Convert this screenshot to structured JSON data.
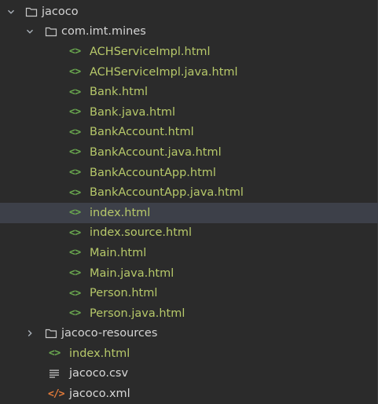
{
  "colors": {
    "background": "#2b2b2b",
    "selected_row": "#3d4049",
    "html_file_text": "#b7c96a",
    "html_icon": "#6aa84f",
    "xml_icon": "#e07a3a"
  },
  "tree": {
    "root": {
      "label": "jacoco",
      "icon": "folder-icon",
      "expanded": true
    },
    "package": {
      "label": "com.imt.mines",
      "icon": "folder-icon",
      "expanded": true
    },
    "package_files": [
      {
        "label": "ACHServiceImpl.html",
        "icon": "html-icon"
      },
      {
        "label": "ACHServiceImpl.java.html",
        "icon": "html-icon"
      },
      {
        "label": "Bank.html",
        "icon": "html-icon"
      },
      {
        "label": "Bank.java.html",
        "icon": "html-icon"
      },
      {
        "label": "BankAccount.html",
        "icon": "html-icon"
      },
      {
        "label": "BankAccount.java.html",
        "icon": "html-icon"
      },
      {
        "label": "BankAccountApp.html",
        "icon": "html-icon"
      },
      {
        "label": "BankAccountApp.java.html",
        "icon": "html-icon"
      },
      {
        "label": "index.html",
        "icon": "html-icon",
        "selected": true
      },
      {
        "label": "index.source.html",
        "icon": "html-icon"
      },
      {
        "label": "Main.html",
        "icon": "html-icon"
      },
      {
        "label": "Main.java.html",
        "icon": "html-icon"
      },
      {
        "label": "Person.html",
        "icon": "html-icon"
      },
      {
        "label": "Person.java.html",
        "icon": "html-icon"
      }
    ],
    "resources_folder": {
      "label": "jacoco-resources",
      "icon": "folder-icon",
      "expanded": false
    },
    "root_files": [
      {
        "label": "index.html",
        "icon": "html-icon"
      },
      {
        "label": "jacoco.csv",
        "icon": "csv-icon"
      },
      {
        "label": "jacoco.xml",
        "icon": "xml-icon"
      }
    ],
    "icon_glyphs": {
      "html": "<>",
      "xml": "</>"
    }
  }
}
